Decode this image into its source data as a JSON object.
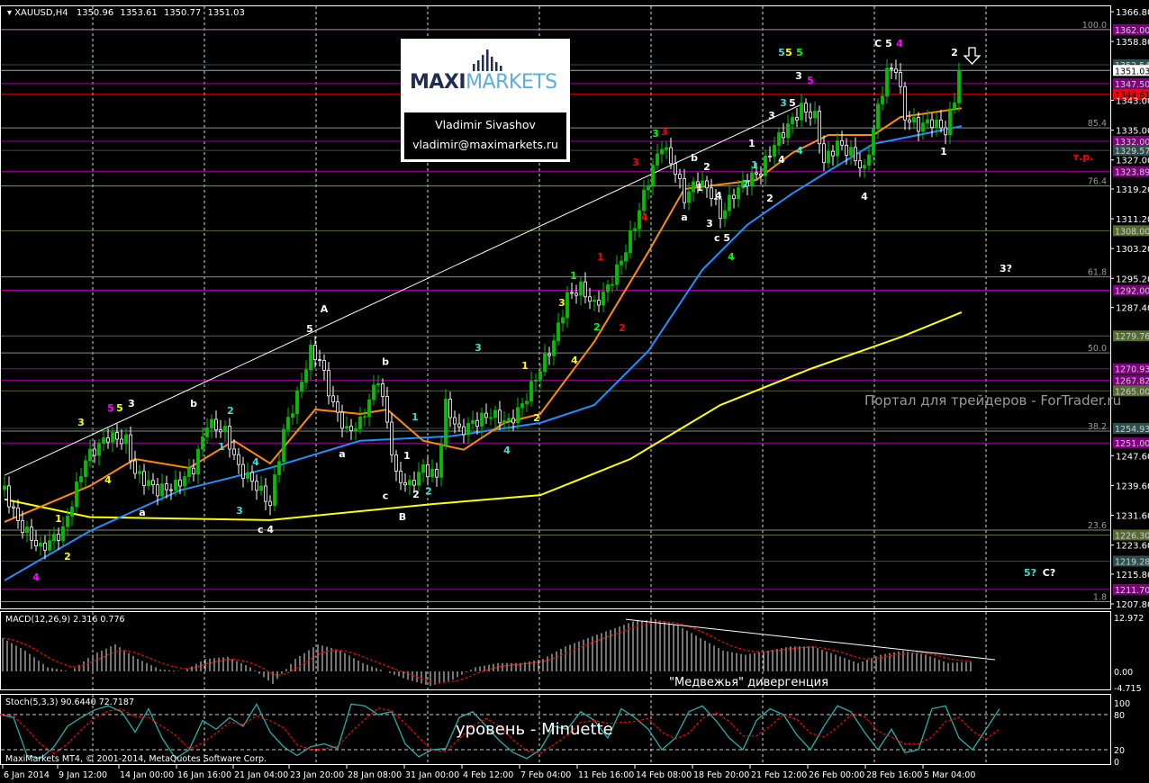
{
  "header": {
    "symbol": "XAUUSD,H4",
    "open": "1350.96",
    "high": "1353.61",
    "low": "1350.77",
    "close": "1351.03"
  },
  "logo": {
    "brand_dark": "MAXI",
    "brand_light": "MARKETS",
    "author": "Vladimir Sivashov",
    "email": "vladimir@maximarkets.ru"
  },
  "annotations": {
    "watermark": "Портал для трейдеров - ForTrader.ru",
    "divergence": "\"Медвежья\" дивергенция",
    "level": "уровень - Minuette",
    "copyright": "MaxiMarkets MT4, © 2001-2014, MetaQuotes Software Corp."
  },
  "colors": {
    "bull": "#00c000",
    "bear": "#ffffff",
    "ma_slow": "#ffff00",
    "ma_mid": "#1e90ff",
    "ma_fast": "#ff8c00",
    "stoch": "#20b2aa",
    "signal": "#ff0000"
  },
  "chart_data": {
    "type": "candlestick",
    "title": "XAUUSD,H4",
    "ylim": [
      1207.8,
      1366.8
    ],
    "grid": true,
    "price_ticks": [
      "1366.80",
      "1358.80",
      "1343.00",
      "1335.00",
      "1327.00",
      "1319.20",
      "1311.20",
      "1303.20",
      "1295.20",
      "1287.40",
      "1247.60",
      "1239.60",
      "1231.60",
      "1223.60",
      "1215.80",
      "1207.80"
    ],
    "current_price": "1351.03",
    "time_labels": [
      "6 Jan 2014",
      "9 Jan 12:00",
      "14 Jan 00:00",
      "16 Jan 16:00",
      "21 Jan 04:00",
      "23 Jan 20:00",
      "28 Jan 08:00",
      "31 Jan 00:00",
      "4 Feb 12:00",
      "7 Feb 04:00",
      "11 Feb 16:00",
      "14 Feb 08:00",
      "18 Feb 20:00",
      "21 Feb 12:00",
      "26 Feb 00:00",
      "28 Feb 16:00",
      "5 Mar 04:00"
    ],
    "closes": [
      [
        1,
        1238.3
      ],
      [
        4,
        1229.8
      ],
      [
        9,
        1222.6
      ],
      [
        14,
        1227.4
      ],
      [
        19,
        1246.7
      ],
      [
        24,
        1252.8
      ],
      [
        28,
        1251.6
      ],
      [
        30,
        1243
      ],
      [
        35,
        1238.3
      ],
      [
        39,
        1239.5
      ],
      [
        43,
        1244.3
      ],
      [
        46,
        1256.4
      ],
      [
        50,
        1254
      ],
      [
        53,
        1244.3
      ],
      [
        57,
        1239.5
      ],
      [
        60,
        1234.6
      ],
      [
        63,
        1254
      ],
      [
        66,
        1263.6
      ],
      [
        69,
        1275.7
      ],
      [
        71,
        1273.3
      ],
      [
        74,
        1261.2
      ],
      [
        77,
        1254
      ],
      [
        80,
        1256.4
      ],
      [
        84,
        1268.5
      ],
      [
        86,
        1256.4
      ],
      [
        88,
        1241.9
      ],
      [
        91,
        1239.5
      ],
      [
        94,
        1244.3
      ],
      [
        97,
        1241.9
      ],
      [
        99,
        1261.2
      ],
      [
        102,
        1254
      ],
      [
        105,
        1256.4
      ],
      [
        109,
        1258.8
      ],
      [
        113,
        1256.4
      ],
      [
        116,
        1261.2
      ],
      [
        119,
        1268.5
      ],
      [
        123,
        1278.2
      ],
      [
        126,
        1290.3
      ],
      [
        129,
        1292.7
      ],
      [
        132,
        1287.9
      ],
      [
        135,
        1292.7
      ],
      [
        138,
        1300
      ],
      [
        141,
        1309.6
      ],
      [
        144,
        1321.6
      ],
      [
        147,
        1331.3
      ],
      [
        150,
        1324
      ],
      [
        152,
        1316.8
      ],
      [
        155,
        1321.6
      ],
      [
        158,
        1318
      ],
      [
        160,
        1312
      ],
      [
        163,
        1318
      ],
      [
        166,
        1321.6
      ],
      [
        169,
        1324
      ],
      [
        172,
        1331.3
      ],
      [
        175,
        1336.1
      ],
      [
        178,
        1340.9
      ],
      [
        181,
        1338.5
      ],
      [
        183,
        1326.4
      ],
      [
        186,
        1331.3
      ],
      [
        189,
        1328.9
      ],
      [
        192,
        1324
      ],
      [
        195,
        1340.9
      ],
      [
        197,
        1350.6
      ],
      [
        199,
        1351.8
      ],
      [
        201,
        1338.5
      ],
      [
        204,
        1336.1
      ],
      [
        207,
        1337.3
      ],
      [
        210,
        1334.9
      ],
      [
        212,
        1343.3
      ],
      [
        213,
        1351.03
      ]
    ],
    "moving_averages": [
      {
        "name": "slow",
        "color": "#ffff00",
        "points": [
          [
            1,
            1235.9
          ],
          [
            20,
            1231.1
          ],
          [
            60,
            1230.3
          ],
          [
            96,
            1234.6
          ],
          [
            120,
            1237
          ],
          [
            140,
            1246.7
          ],
          [
            160,
            1261.2
          ],
          [
            180,
            1270.9
          ],
          [
            200,
            1279.4
          ],
          [
            213.6,
            1286.1
          ]
        ]
      },
      {
        "name": "mid",
        "color": "#1e90ff",
        "points": [
          [
            1,
            1214.1
          ],
          [
            20,
            1227.4
          ],
          [
            40,
            1238.3
          ],
          [
            60,
            1244.3
          ],
          [
            80,
            1251.6
          ],
          [
            100,
            1252.8
          ],
          [
            120,
            1256.4
          ],
          [
            132,
            1261.2
          ],
          [
            144,
            1275.7
          ],
          [
            156,
            1297.5
          ],
          [
            166,
            1309.6
          ],
          [
            176,
            1318
          ],
          [
            184,
            1324
          ],
          [
            194,
            1331.3
          ],
          [
            204,
            1333.7
          ],
          [
            213.6,
            1336.1
          ]
        ]
      },
      {
        "name": "fast",
        "color": "#ff8c00",
        "points": [
          [
            1,
            1229.8
          ],
          [
            20,
            1239.5
          ],
          [
            30,
            1246.7
          ],
          [
            42,
            1244.3
          ],
          [
            52,
            1251.6
          ],
          [
            60,
            1245.5
          ],
          [
            70,
            1260
          ],
          [
            80,
            1258.8
          ],
          [
            86,
            1260
          ],
          [
            94,
            1251.6
          ],
          [
            103,
            1249.2
          ],
          [
            112,
            1256.4
          ],
          [
            120,
            1258.8
          ],
          [
            132,
            1278.2
          ],
          [
            144,
            1302.3
          ],
          [
            152,
            1319.2
          ],
          [
            160,
            1320.4
          ],
          [
            168,
            1321.6
          ],
          [
            176,
            1328.9
          ],
          [
            184,
            1333.7
          ],
          [
            194,
            1333.7
          ],
          [
            200,
            1338.5
          ],
          [
            213.6,
            1340.9
          ]
        ]
      }
    ],
    "levels": [
      {
        "price": 1362.0,
        "label": "1362.00",
        "color": "#800080",
        "line": "#c000c0"
      },
      {
        "price": 1352.54,
        "label": "1352.54",
        "color": "#2f4f4f",
        "line": "#2f4f4f"
      },
      {
        "price": 1351.03,
        "label": "1351.03",
        "color": "#ffffff",
        "line": "#a0a8b8"
      },
      {
        "price": 1347.5,
        "label": "1347.50",
        "color": "#800080",
        "line": "#a000a0"
      },
      {
        "price": 1344.61,
        "label": "1344.61",
        "color": "#ff0000",
        "line": "#ff0000"
      },
      {
        "price": 1332.0,
        "label": "1332.00",
        "color": "#800080",
        "line": "#a000a0"
      },
      {
        "price": 1329.57,
        "label": "1329.57",
        "color": "#2f4f4f",
        "line": "#2f4f4f"
      },
      {
        "price": 1323.89,
        "label": "1323.89",
        "color": "#800080",
        "line": "#a000a0"
      },
      {
        "price": 1308.0,
        "label": "1308.00",
        "color": "#556b2f",
        "line": "#556b2f"
      },
      {
        "price": 1292.0,
        "label": "1292.00",
        "color": "#800080",
        "line": "#a000a0"
      },
      {
        "price": 1279.76,
        "label": "1279.76",
        "color": "#556b2f",
        "line": "#556b2f"
      },
      {
        "price": 1270.93,
        "label": "1270.93",
        "color": "#800080",
        "line": "#a000a0"
      },
      {
        "price": 1267.82,
        "label": "1267.82",
        "color": "#800080",
        "line": "#a000a0"
      },
      {
        "price": 1265.0,
        "label": "1265.00",
        "color": "#556b2f",
        "line": "#556b2f"
      },
      {
        "price": 1254.93,
        "label": "1254.93",
        "color": "#2f4f4f",
        "line": "#2f4f4f"
      },
      {
        "price": 1251.0,
        "label": "1251.00",
        "color": "#800080",
        "line": "#a000a0"
      },
      {
        "price": 1226.3,
        "label": "1226.30",
        "color": "#556b2f",
        "line": "#556b2f"
      },
      {
        "price": 1219.28,
        "label": "1219.28",
        "color": "#2f4f4f",
        "line": "#2f4f4f"
      },
      {
        "price": 1211.7,
        "label": "1211.70",
        "color": "#800080",
        "line": "#a000a0"
      }
    ],
    "fibo": [
      {
        "price": 1362.0,
        "label": "100.0"
      },
      {
        "price": 1335.6,
        "label": "85.4"
      },
      {
        "price": 1320.0,
        "label": "76.4"
      },
      {
        "price": 1295.6,
        "label": "61.8"
      },
      {
        "price": 1275.2,
        "label": "50.0"
      },
      {
        "price": 1254.2,
        "label": "38.2"
      },
      {
        "price": 1227.6,
        "label": "23.6"
      },
      {
        "price": 1208.4,
        "label": "1.8"
      }
    ],
    "trendline": [
      [
        1,
        1242.3
      ],
      [
        178,
        1341.9
      ]
    ],
    "wave_labels": [
      [
        18,
        1255.7,
        "3",
        "#ffff00"
      ],
      [
        24.6,
        1259.5,
        "5",
        "#ff00ff"
      ],
      [
        26.6,
        1259.5,
        "5",
        "#ffff00"
      ],
      [
        29.2,
        1260.7,
        "3",
        "#ffffff"
      ],
      [
        24,
        1240.2,
        "4",
        "#ffff00"
      ],
      [
        13,
        1229.8,
        "1",
        "#ffff00"
      ],
      [
        15,
        1219.7,
        "2",
        "#ffff00"
      ],
      [
        8,
        1214.1,
        "4",
        "#ff00ff"
      ],
      [
        31.6,
        1231.5,
        "a",
        "#ffffff"
      ],
      [
        43,
        1260.7,
        "b",
        "#ffffff"
      ],
      [
        49.2,
        1249.1,
        "1",
        "#40e0d0"
      ],
      [
        51.2,
        1258.8,
        "2",
        "#40e0d0"
      ],
      [
        56.8,
        1245,
        "4",
        "#40e0d0"
      ],
      [
        53.2,
        1232,
        "3",
        "#40e0d0"
      ],
      [
        59,
        1226.9,
        "c 4",
        "#ffffff"
      ],
      [
        68.8,
        1280.8,
        "5",
        "#ffffff"
      ],
      [
        72,
        1286.1,
        "A",
        "#ffffff"
      ],
      [
        85.6,
        1271.9,
        "b",
        "#ffffff"
      ],
      [
        76,
        1247.2,
        "a",
        "#ffffff"
      ],
      [
        85.6,
        1235.9,
        "c",
        "#ffffff"
      ],
      [
        89.4,
        1230.3,
        "B",
        "#ffffff"
      ],
      [
        90.4,
        1246.7,
        "1",
        "#ffffff"
      ],
      [
        92.2,
        1257.1,
        "1",
        "#40e0d0"
      ],
      [
        92.4,
        1236.3,
        "2",
        "#ffffff"
      ],
      [
        95.2,
        1237.1,
        "2",
        "#40e0d0"
      ],
      [
        106.2,
        1275.7,
        "3",
        "#40e0d0"
      ],
      [
        116.6,
        1270.9,
        "1",
        "#ffff00"
      ],
      [
        119.2,
        1256.9,
        "2",
        "#ffff00"
      ],
      [
        112.6,
        1248.2,
        "4",
        "#40e0d0"
      ],
      [
        124.8,
        1287.8,
        "3",
        "#ffff00"
      ],
      [
        127.6,
        1272.3,
        "4",
        "#ffff00"
      ],
      [
        127.4,
        1295,
        "1",
        "#00ff00"
      ],
      [
        132.6,
        1281.3,
        "2",
        "#00ff00"
      ],
      [
        133.4,
        1300.1,
        "1",
        "#ff0000"
      ],
      [
        138.2,
        1281,
        "2",
        "#ff0000"
      ],
      [
        141.2,
        1325.5,
        "3",
        "#ff0000"
      ],
      [
        143.2,
        1310.7,
        "4",
        "#ff0000"
      ],
      [
        145.6,
        1333.2,
        "3",
        "#00ff00"
      ],
      [
        147.6,
        1333.7,
        "3",
        "#ff0000"
      ],
      [
        152,
        1310.7,
        "a",
        "#ffffff"
      ],
      [
        154.2,
        1326.7,
        "b",
        "#ffffff"
      ],
      [
        157,
        1324.3,
        "2",
        "#ffffff"
      ],
      [
        155.4,
        1318.7,
        "1",
        "#ffffff"
      ],
      [
        159.6,
        1316.5,
        "4",
        "#ffffff"
      ],
      [
        157.6,
        1309,
        "3",
        "#ffffff"
      ],
      [
        160.4,
        1305.2,
        "c 5",
        "#ffffff"
      ],
      [
        162.4,
        1300.1,
        "4",
        "#00ff00"
      ],
      [
        165.6,
        1319.7,
        "2",
        "#40e0d0"
      ],
      [
        171,
        1315.8,
        "2",
        "#ffffff"
      ],
      [
        167.6,
        1324.8,
        "1",
        "#40e0d0"
      ],
      [
        167,
        1330.6,
        "1",
        "#ffffff"
      ],
      [
        173.6,
        1326.2,
        "4",
        "#ffffff"
      ],
      [
        171.4,
        1338,
        "3",
        "#ffffff"
      ],
      [
        174,
        1341.4,
        "3",
        "#40e0d0"
      ],
      [
        176,
        1341.4,
        "5",
        "#ffffff"
      ],
      [
        177.4,
        1348.7,
        "3",
        "#ffffff"
      ],
      [
        180,
        1347.5,
        "5",
        "#ff00ff"
      ],
      [
        177.6,
        1328.6,
        "4",
        "#40e0d0"
      ],
      [
        173.6,
        1355,
        "5",
        "#40e0d0"
      ],
      [
        175.2,
        1355,
        "5",
        "#ffff00"
      ],
      [
        177.6,
        1355,
        "5",
        "#00ff00"
      ],
      [
        195,
        1357.4,
        "C",
        "#ffffff"
      ],
      [
        197.4,
        1357.4,
        "5",
        "#ffffff"
      ],
      [
        199.8,
        1357.4,
        "4",
        "#ff00ff"
      ],
      [
        192,
        1316.3,
        "4",
        "#ffffff"
      ],
      [
        209.6,
        1328.4,
        "1",
        "#ffffff"
      ],
      [
        212,
        1355,
        "2",
        "#ffffff"
      ],
      [
        223.4,
        1297,
        "3?",
        "#ffffff"
      ],
      [
        228.8,
        1215.3,
        "5?",
        "#40e0d0"
      ],
      [
        233,
        1215.3,
        "C?",
        "#ffffff"
      ],
      [
        240.6,
        1326.9,
        "т.р.",
        "#ff0000"
      ]
    ],
    "macd": {
      "label": "MACD(12,26,9) 2.316 0.776",
      "ticks": [
        "12.972",
        "0.00",
        "-4.715"
      ],
      "histogram_every_5_bars": [
        8,
        5,
        1,
        0,
        4,
        6.5,
        3,
        0.5,
        0,
        3,
        3.5,
        1,
        -3,
        3,
        6.5,
        5,
        2,
        0,
        -2,
        -3.5,
        -2,
        1,
        2,
        2,
        3,
        6,
        8,
        10,
        12,
        12.5,
        11,
        8,
        5,
        4,
        5,
        6,
        6,
        4,
        2,
        4,
        5,
        4,
        2,
        2.3
      ],
      "divergence_line": [
        [
          139,
          12.5
        ],
        [
          221,
          2.8
        ]
      ]
    },
    "stoch": {
      "label": "Stoch(5,3,3) 90.6440 72.7187",
      "ticks": [
        "100",
        "80",
        "20",
        "0"
      ],
      "levels": [
        80,
        20
      ],
      "main_every_3_bars": [
        80,
        75,
        10,
        5,
        25,
        60,
        75,
        88,
        95,
        85,
        50,
        90,
        40,
        5,
        20,
        70,
        55,
        75,
        60,
        98,
        50,
        25,
        10,
        25,
        30,
        22,
        98,
        95,
        80,
        85,
        30,
        8,
        20,
        22,
        75,
        85,
        60,
        35,
        15,
        5,
        20,
        60,
        55,
        85,
        70,
        40,
        90,
        75,
        55,
        20,
        40,
        85,
        95,
        70,
        40,
        20,
        70,
        90,
        80,
        45,
        20,
        60,
        95,
        85,
        50,
        20,
        55,
        15,
        20,
        90,
        95,
        40,
        20,
        55,
        90
      ]
    }
  }
}
